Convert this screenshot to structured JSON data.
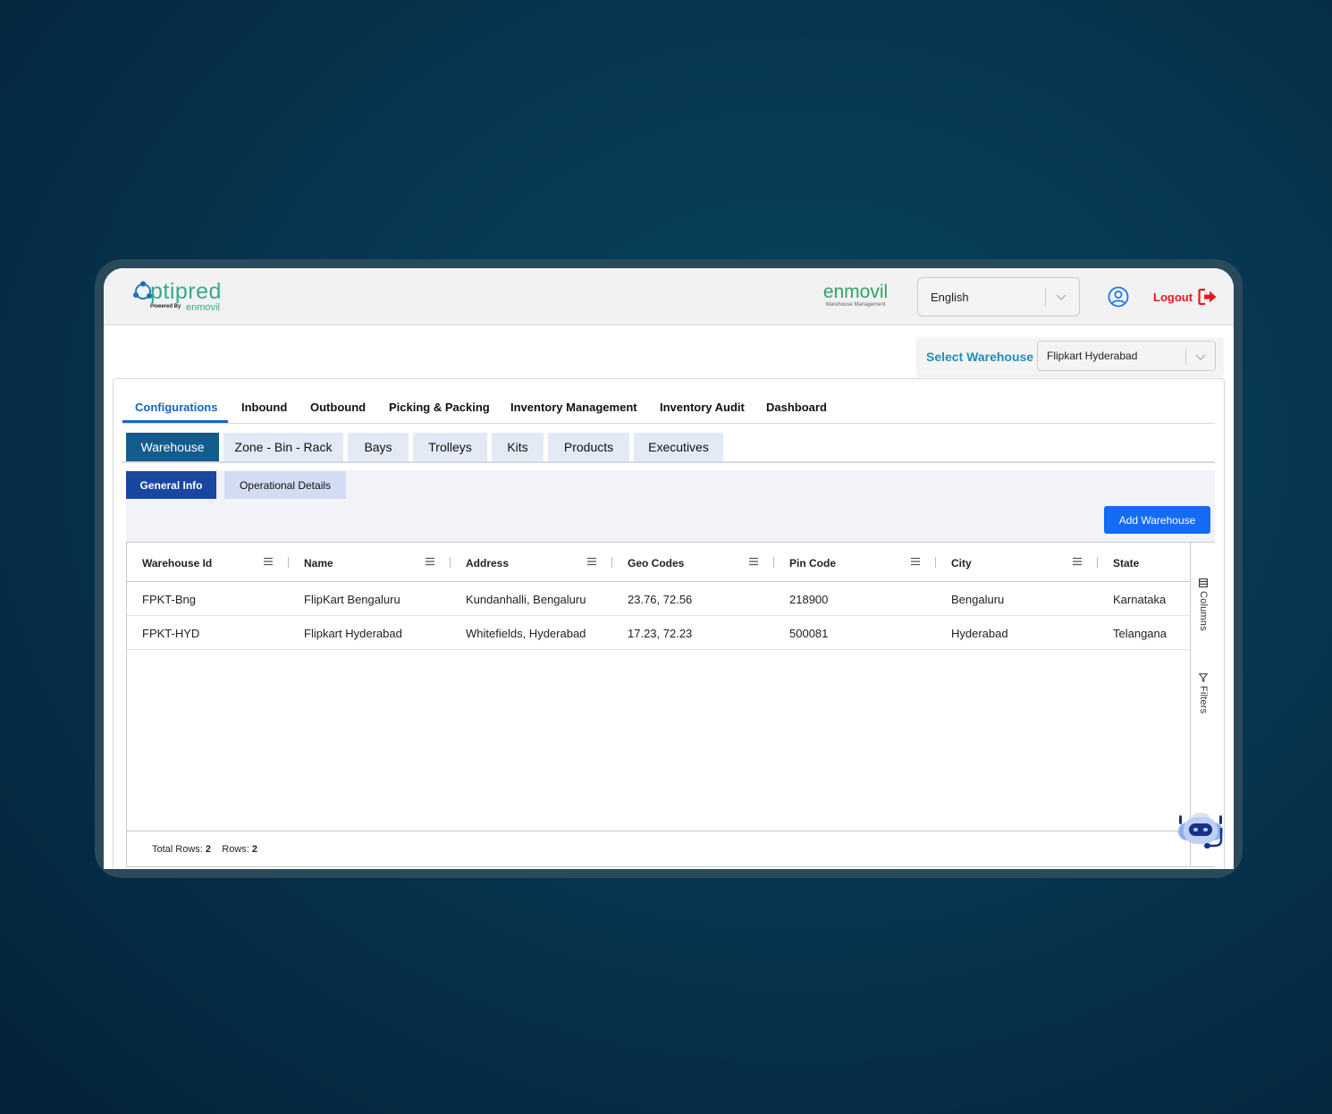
{
  "header": {
    "logo_text": "ptipred",
    "logo_powered_by": "Powered By",
    "logo_powered_brand": "enmovil",
    "brand_name": "enmovil",
    "brand_tagline": "Warehouse Management",
    "language_value": "English",
    "logout_label": "Logout"
  },
  "warehouse_selector": {
    "label": "Select Warehouse",
    "value": "Flipkart Hyderabad"
  },
  "main_tabs": [
    {
      "label": "Configurations",
      "active": true
    },
    {
      "label": "Inbound"
    },
    {
      "label": "Outbound"
    },
    {
      "label": "Picking & Packing"
    },
    {
      "label": "Inventory Management"
    },
    {
      "label": "Inventory Audit"
    },
    {
      "label": "Dashboard"
    }
  ],
  "sub_tabs": [
    {
      "label": "Warehouse",
      "active": true
    },
    {
      "label": "Zone - Bin - Rack"
    },
    {
      "label": "Bays"
    },
    {
      "label": "Trolleys"
    },
    {
      "label": "Kits"
    },
    {
      "label": "Products"
    },
    {
      "label": "Executives"
    }
  ],
  "info_tabs": [
    {
      "label": "General Info",
      "active": true
    },
    {
      "label": "Operational Details"
    }
  ],
  "add_button_label": "Add Warehouse",
  "table": {
    "columns": [
      "Warehouse Id",
      "Name",
      "Address",
      "Geo Codes",
      "Pin Code",
      "City",
      "State"
    ],
    "rows": [
      [
        "FPKT-Bng",
        "FlipKart Bengaluru",
        "Kundanhalli, Bengaluru",
        "23.76, 72.56",
        "218900",
        "Bengaluru",
        "Karnataka"
      ],
      [
        "FPKT-HYD",
        "Flipkart Hyderabad",
        "Whitefields, Hyderabad",
        "17.23, 72.23",
        "500081",
        "Hyderabad",
        "Telangana"
      ]
    ],
    "side_columns_label": "Columns",
    "side_filters_label": "Filters",
    "footer": {
      "total_rows_label": "Total Rows:",
      "total_rows": "2",
      "rows_label": "Rows:",
      "rows": "2"
    }
  },
  "colors": {
    "accent": "#1565c0",
    "sub_tab_active": "#135c8e",
    "info_tab_active": "#1947a0",
    "button": "#136cf3",
    "logout": "#e8171f",
    "brand_green": "#2ea36a"
  }
}
